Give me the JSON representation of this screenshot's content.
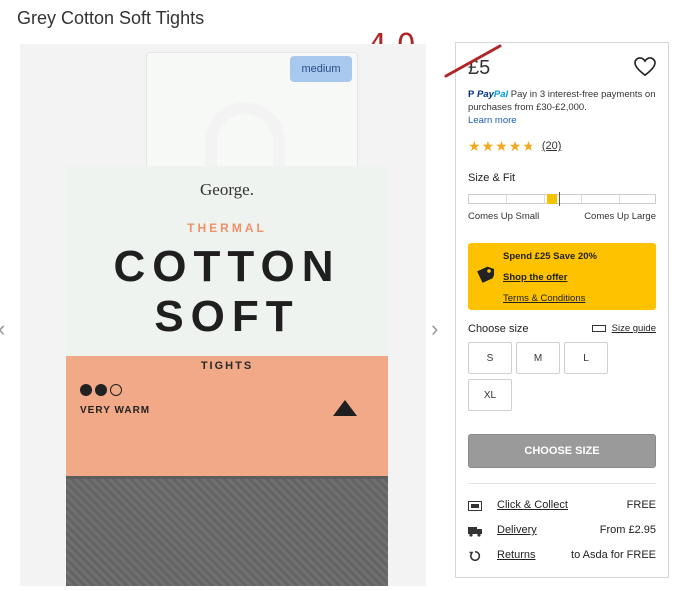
{
  "page": {
    "title": "Grey Cotton Soft Tights",
    "annotation": "4.0"
  },
  "image": {
    "sticker": "medium",
    "brand": "George.",
    "line1": "THERMAL",
    "line2": "COTTON",
    "line3": "SOFT",
    "line4": "TIGHTS",
    "warmth": "VERY WARM",
    "warmth_level": 2,
    "warmth_max": 3,
    "prev_arrow": "‹",
    "next_arrow": "›"
  },
  "purchase": {
    "price": "£5",
    "paypal_brand_a": "Pay",
    "paypal_brand_b": "Pal",
    "paypal_text": "Pay in 3 interest-free payments on purchases from £30-£2,000.",
    "learn_more": "Learn more",
    "rating": 4.5,
    "review_count": "(20)",
    "size_fit_title": "Size & Fit",
    "fit_position": 0.46,
    "fit_low": "Comes Up Small",
    "fit_high": "Comes Up Large",
    "promo_title": "Spend £25 Save 20%",
    "promo_link": "Shop the offer",
    "promo_terms": "Terms & Conditions",
    "choose_size": "Choose size",
    "size_guide": "Size guide",
    "sizes": [
      "S",
      "M",
      "L",
      "XL"
    ],
    "cta": "CHOOSE SIZE",
    "delivery": [
      {
        "icon": "store-icon",
        "label": "Click & Collect",
        "value": "FREE"
      },
      {
        "icon": "truck-icon",
        "label": "Delivery",
        "value": "From £2.95"
      },
      {
        "icon": "returns-icon",
        "label": "Returns",
        "value": "to Asda for FREE"
      }
    ]
  },
  "colors": {
    "promo": "#ffc200",
    "star": "#f4a81d",
    "annotation": "#b02626",
    "cta": "#9a9a9a"
  }
}
